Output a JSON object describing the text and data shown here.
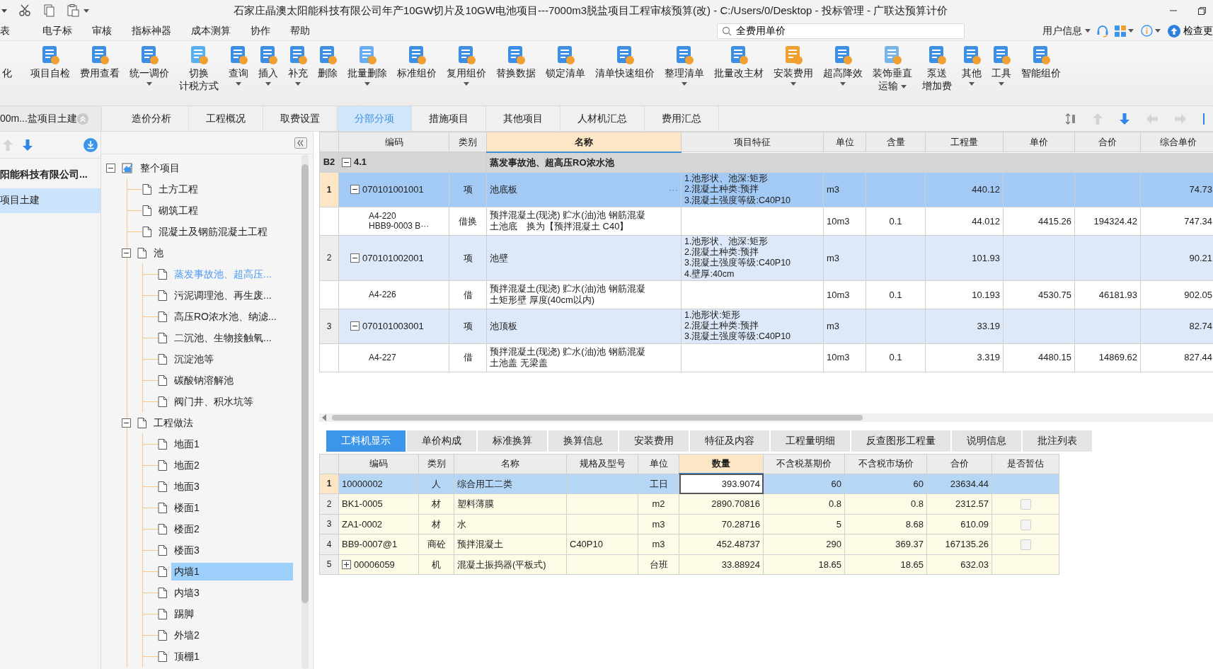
{
  "window": {
    "title": "石家庄晶澳太阳能科技有限公司年产10GW切片及10GW电池项目---7000m3脱盐项目工程审核预算(改) - C:/Users/0/Desktop - 投标管理 - 广联达预算计价"
  },
  "menu": [
    {
      "label": "表"
    },
    {
      "label": "电子标"
    },
    {
      "label": "审核"
    },
    {
      "label": "指标神器"
    },
    {
      "label": "成本测算"
    },
    {
      "label": "协作"
    },
    {
      "label": "帮助"
    }
  ],
  "search": {
    "value": "全费用单价"
  },
  "header_right": {
    "user": "用户信息",
    "update": "检查更"
  },
  "toolbar": [
    {
      "label": "化",
      "dropdown": false
    },
    {
      "label": "项目自检",
      "dropdown": false
    },
    {
      "label": "费用查看",
      "dropdown": false
    },
    {
      "label": "统一调价",
      "dropdown": true
    },
    {
      "lines": [
        "切换",
        "计税方式"
      ],
      "dropdown": false
    },
    {
      "label": "查询",
      "dropdown": true
    },
    {
      "label": "插入",
      "dropdown": true
    },
    {
      "label": "补充",
      "dropdown": true
    },
    {
      "label": "删除",
      "dropdown": false
    },
    {
      "label": "批量删除",
      "dropdown": true
    },
    {
      "label": "标准组价",
      "dropdown": false
    },
    {
      "label": "复用组价",
      "dropdown": true
    },
    {
      "label": "替换数据",
      "dropdown": false
    },
    {
      "label": "锁定清单",
      "dropdown": false
    },
    {
      "label": "清单快速组价",
      "dropdown": false
    },
    {
      "label": "整理清单",
      "dropdown": true
    },
    {
      "label": "批量改主材",
      "dropdown": false
    },
    {
      "label": "安装费用",
      "dropdown": true
    },
    {
      "label": "超高降效",
      "dropdown": true
    },
    {
      "lines": [
        "装饰垂直",
        "运输"
      ],
      "dropdown": true
    },
    {
      "lines": [
        "泵送",
        "增加费"
      ],
      "dropdown": false
    },
    {
      "label": "其他",
      "dropdown": true
    },
    {
      "label": "工具",
      "dropdown": true
    },
    {
      "label": "智能组价",
      "dropdown": false
    }
  ],
  "project_tab": {
    "label": "00m...盐项目土建"
  },
  "tabs": [
    {
      "label": "造价分析",
      "selected": false
    },
    {
      "label": "工程概况",
      "selected": false
    },
    {
      "label": "取费设置",
      "selected": false
    },
    {
      "label": "分部分项",
      "selected": true
    },
    {
      "label": "措施项目",
      "selected": false
    },
    {
      "label": "其他项目",
      "selected": false
    },
    {
      "label": "人材机汇总",
      "selected": false
    },
    {
      "label": "费用汇总",
      "selected": false
    }
  ],
  "project_list": [
    {
      "label": "阳能科技有限公司...",
      "kind": "group",
      "selected": false
    },
    {
      "label": "项目土建",
      "kind": "item",
      "selected": true
    }
  ],
  "tree": [
    {
      "label": "整个项目",
      "selected": false,
      "current": false,
      "expanded": true,
      "children": [
        {
          "label": "土方工程",
          "selected": false,
          "current": false
        },
        {
          "label": "砌筑工程",
          "selected": false,
          "current": false
        },
        {
          "label": "混凝土及钢筋混凝土工程",
          "selected": false,
          "current": false
        },
        {
          "label": "池",
          "selected": false,
          "current": false,
          "expanded": true,
          "children": [
            {
              "label": "蒸发事故池、超高压...",
              "selected": false,
              "current": true
            },
            {
              "label": "污泥调理池、再生废...",
              "selected": false,
              "current": false
            },
            {
              "label": "高压RO浓水池、纳滤...",
              "selected": false,
              "current": false
            },
            {
              "label": "二沉池、生物接触氧...",
              "selected": false,
              "current": false
            },
            {
              "label": "沉淀池等",
              "selected": false,
              "current": false
            },
            {
              "label": "碳酸钠溶解池",
              "selected": false,
              "current": false
            },
            {
              "label": "阀门井、积水坑等",
              "selected": false,
              "current": false
            }
          ]
        },
        {
          "label": "工程做法",
          "selected": false,
          "current": false,
          "expanded": true,
          "children": [
            {
              "label": "地面1",
              "selected": false,
              "current": false
            },
            {
              "label": "地面2",
              "selected": false,
              "current": false
            },
            {
              "label": "地面3",
              "selected": false,
              "current": false
            },
            {
              "label": "楼面1",
              "selected": false,
              "current": false
            },
            {
              "label": "楼面2",
              "selected": false,
              "current": false
            },
            {
              "label": "楼面3",
              "selected": false,
              "current": false
            },
            {
              "label": "内墙1",
              "selected": true,
              "current": false
            },
            {
              "label": "内墙3",
              "selected": false,
              "current": false
            },
            {
              "label": "踢脚",
              "selected": false,
              "current": false
            },
            {
              "label": "外墙2",
              "selected": false,
              "current": false
            },
            {
              "label": "顶棚1",
              "selected": false,
              "current": false
            }
          ]
        }
      ]
    }
  ],
  "table": {
    "columns": [
      {
        "label": "编码",
        "selected": false
      },
      {
        "label": "类别",
        "selected": false
      },
      {
        "label": "名称",
        "selected": true
      },
      {
        "label": "项目特征",
        "selected": false
      },
      {
        "label": "单位",
        "selected": false
      },
      {
        "label": "含量",
        "selected": false
      },
      {
        "label": "工程量",
        "selected": false
      },
      {
        "label": "单价",
        "selected": false
      },
      {
        "label": "合价",
        "selected": false
      },
      {
        "label": "综合单价",
        "selected": false
      }
    ],
    "rows": [
      {
        "kind": "section",
        "number": "B2",
        "code": "4.1",
        "name": "蒸发事故池、超高压RO浓水池",
        "expanded": true,
        "selected": false
      },
      {
        "kind": "item",
        "number": "1",
        "code": "070101001001",
        "type": "项",
        "name": "池底板",
        "name_button": "···",
        "features": "1.池形状、池深:矩形\n2.混凝土种类:预拌\n3.混凝土强度等级:C40P10",
        "unit": "m3",
        "quantity": "440.12",
        "composite_price": "74.73",
        "expanded": true,
        "selected": true
      },
      {
        "kind": "sub",
        "code": "A4-220\nHBB9-0003 B···",
        "type": "借换",
        "name": "预拌混凝土(现浇) 贮水(油)池 钢筋混凝土池底　换为【预拌混凝土 C40】",
        "unit": "10m3",
        "content": "0.1",
        "quantity": "44.012",
        "unit_price": "4415.26",
        "total": "194324.42",
        "composite_price": "747.34",
        "selected": false
      },
      {
        "kind": "item",
        "number": "2",
        "code": "070101002001",
        "type": "项",
        "name": "池壁",
        "features": "1.池形状、池深:矩形\n2.混凝土种类:预拌\n3.混凝土强度等级:C40P10\n4.壁厚:40cm",
        "unit": "m3",
        "quantity": "101.93",
        "composite_price": "90.21",
        "expanded": true,
        "selected": false
      },
      {
        "kind": "sub",
        "code": "A4-226",
        "type": "借",
        "name": "预拌混凝土(现浇) 贮水(油)池 钢筋混凝土矩形壁 厚度(40cm以内)",
        "unit": "10m3",
        "content": "0.1",
        "quantity": "10.193",
        "unit_price": "4530.75",
        "total": "46181.93",
        "composite_price": "902.05",
        "selected": false
      },
      {
        "kind": "item",
        "number": "3",
        "code": "070101003001",
        "type": "项",
        "name": "池顶板",
        "features": "1.池形状:矩形\n2.混凝土种类:预拌\n3.混凝土强度等级:C40P10",
        "unit": "m3",
        "quantity": "33.19",
        "composite_price": "82.74",
        "expanded": true,
        "selected": false
      },
      {
        "kind": "sub",
        "code": "A4-227",
        "type": "借",
        "name": "预拌混凝土(现浇) 贮水(油)池 钢筋混凝土池盖 无梁盖",
        "unit": "10m3",
        "content": "0.1",
        "quantity": "3.319",
        "unit_price": "4480.15",
        "total": "14869.62",
        "composite_price": "827.44",
        "selected": false
      }
    ]
  },
  "detail_tabs": [
    {
      "label": "工料机显示",
      "selected": true
    },
    {
      "label": "单价构成",
      "selected": false
    },
    {
      "label": "标准换算",
      "selected": false
    },
    {
      "label": "换算信息",
      "selected": false
    },
    {
      "label": "安装费用",
      "selected": false
    },
    {
      "label": "特征及内容",
      "selected": false
    },
    {
      "label": "工程量明细",
      "selected": false
    },
    {
      "label": "反查图形工程量",
      "selected": false
    },
    {
      "label": "说明信息",
      "selected": false
    },
    {
      "label": "批注列表",
      "selected": false
    }
  ],
  "detail_table": {
    "columns": [
      {
        "label": "编码",
        "selected": false
      },
      {
        "label": "类别",
        "selected": false
      },
      {
        "label": "名称",
        "selected": false
      },
      {
        "label": "规格及型号",
        "selected": false
      },
      {
        "label": "单位",
        "selected": false
      },
      {
        "label": "数量",
        "selected": true
      },
      {
        "label": "不含税基期价",
        "selected": false
      },
      {
        "label": "不含税市场价",
        "selected": false
      },
      {
        "label": "合价",
        "selected": false
      },
      {
        "label": "是否暂估",
        "selected": false
      }
    ],
    "rows": [
      {
        "number": "1",
        "code": "10000002",
        "type": "人",
        "name": "综合用工二类",
        "unit": "工日",
        "quantity": "393.9074",
        "base_price": "60",
        "market_price": "60",
        "total": "23634.44",
        "selected": true
      },
      {
        "number": "2",
        "code": "BK1-0005",
        "type": "材",
        "name": "塑料薄膜",
        "unit": "m2",
        "quantity": "2890.70816",
        "base_price": "0.8",
        "market_price": "0.8",
        "total": "2312.57",
        "provisional": false,
        "selected": false
      },
      {
        "number": "3",
        "code": "ZA1-0002",
        "type": "材",
        "name": "水",
        "unit": "m3",
        "quantity": "70.28716",
        "base_price": "5",
        "market_price": "8.68",
        "total": "610.09",
        "provisional": false,
        "selected": false
      },
      {
        "number": "4",
        "code": "BB9-0007@1",
        "type": "商砼",
        "name": "预拌混凝土",
        "spec": "C40P10",
        "unit": "m3",
        "quantity": "452.48737",
        "base_price": "290",
        "market_price": "369.37",
        "total": "167135.26",
        "provisional": false,
        "selected": false
      },
      {
        "number": "5",
        "code": "00006059",
        "type": "机",
        "name": "混凝土振捣器(平板式)",
        "unit": "台班",
        "quantity": "33.88924",
        "base_price": "18.65",
        "market_price": "18.65",
        "total": "632.03",
        "expanded": false,
        "selected": false
      }
    ]
  }
}
